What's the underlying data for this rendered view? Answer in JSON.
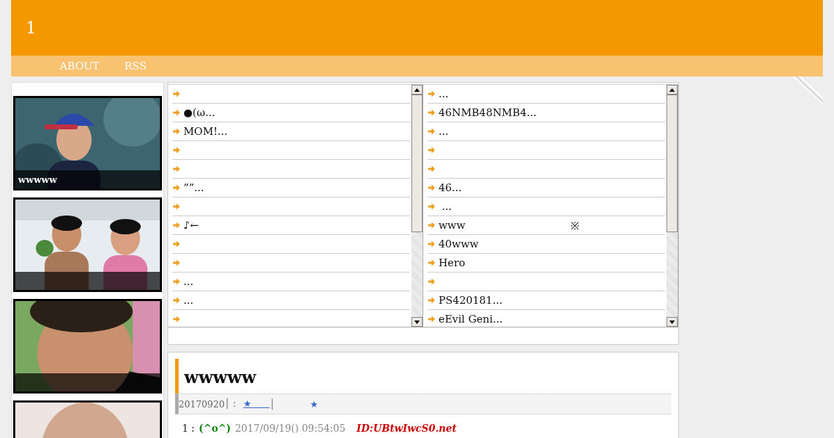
{
  "site": {
    "title": "1"
  },
  "nav": [
    {
      "label": "ABOUT"
    },
    {
      "label": "RSS"
    }
  ],
  "sidebar": {
    "cards": [
      {
        "kind": "picture",
        "caption": "wwwww"
      },
      {
        "kind": "picture"
      },
      {
        "kind": "picture"
      },
      {
        "kind": "picture"
      }
    ]
  },
  "feeds": [
    {
      "items": [
        {
          "kind": "link"
        },
        {
          "kind": "link",
          "title": "●(ω..."
        },
        {
          "kind": "link",
          "title": "MOM!..."
        },
        {
          "kind": "link"
        },
        {
          "kind": "link"
        },
        {
          "kind": "link",
          "title": "””..."
        },
        {
          "kind": "link"
        },
        {
          "kind": "link",
          "title": "♪←"
        },
        {
          "kind": "link"
        },
        {
          "kind": "link"
        },
        {
          "kind": "link",
          "title": "..."
        },
        {
          "kind": "link",
          "title": "..."
        },
        {
          "kind": "link"
        }
      ]
    },
    {
      "items": [
        {
          "kind": "link",
          "title": "..."
        },
        {
          "kind": "link",
          "title": "46NMB48NMB4..."
        },
        {
          "kind": "link",
          "title": "..."
        },
        {
          "kind": "link"
        },
        {
          "kind": "link"
        },
        {
          "kind": "link",
          "title": "46..."
        },
        {
          "kind": "link",
          "title": " ..."
        },
        {
          "kind": "link",
          "title": "www",
          "note": "※"
        },
        {
          "kind": "link",
          "title": "40www"
        },
        {
          "kind": "link",
          "title": "Hero"
        },
        {
          "kind": "link"
        },
        {
          "kind": "link",
          "title": "PS420181..."
        },
        {
          "kind": "link",
          "title": "eEvil Geni..."
        }
      ]
    }
  ],
  "article": {
    "title": "wwwww",
    "meta": {
      "date": "20170920",
      "separator": "│：",
      "link": "★　　",
      "divider": "│",
      "star": "★"
    },
    "comment": {
      "number": "1 :",
      "name": "(^o^)",
      "date": "2017/09/19() 09:54:05",
      "id": "ID:UBtwIwcS0.net"
    }
  }
}
